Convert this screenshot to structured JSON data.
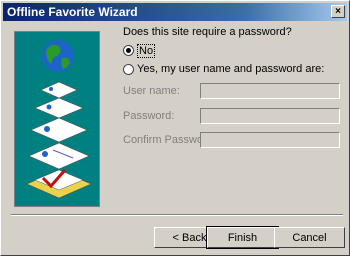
{
  "window": {
    "title": "Offline Favorite Wizard",
    "close_label": "×"
  },
  "question": "Does this site require a password?",
  "options": [
    {
      "label": "No",
      "selected": true
    },
    {
      "label": "Yes, my user name and password are:",
      "selected": false
    }
  ],
  "fields": [
    {
      "label": "User name:",
      "value": ""
    },
    {
      "label": "Password:",
      "value": ""
    },
    {
      "label": "Confirm Password:",
      "value": ""
    }
  ],
  "buttons": {
    "back": "< Back",
    "finish": "Finish",
    "cancel": "Cancel"
  }
}
